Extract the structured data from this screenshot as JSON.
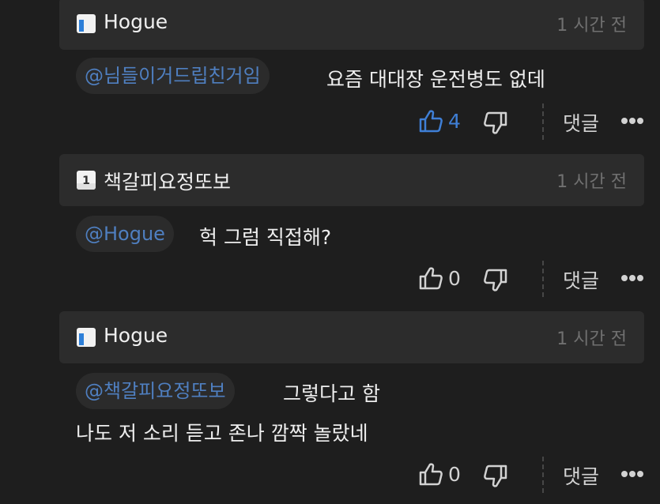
{
  "colors": {
    "background": "#1e1e1e",
    "header_background": "#2c2c2c",
    "mention_blue": "#4f7fc0",
    "liked_blue": "#3f7fd6",
    "level_icon_blue": "#2d7fd8"
  },
  "comments": [
    {
      "level_icon": "level-badge-icon",
      "level_digit": "",
      "nickname": "Hogue",
      "time": "1 시간 전",
      "mention": "@님들이거드립친거임",
      "text_line1": "요즘 대대장 운전병도 없데",
      "text_line2": "",
      "like_count": "4",
      "liked": true,
      "reply_label": "댓글"
    },
    {
      "level_icon": "level-badge-icon",
      "level_digit": "1",
      "nickname": "책갈피요정또보",
      "time": "1 시간 전",
      "mention": "@Hogue",
      "text_line1": "헉 그럼 직접해?",
      "text_line2": "",
      "like_count": "0",
      "liked": false,
      "reply_label": "댓글"
    },
    {
      "level_icon": "level-badge-icon",
      "level_digit": "",
      "nickname": "Hogue",
      "time": "1 시간 전",
      "mention": "@책갈피요정또보",
      "text_line1": "그렇다고 함",
      "text_line2": "나도 저 소리 듣고 존나 깜짝 놀랐네",
      "like_count": "0",
      "liked": false,
      "reply_label": "댓글"
    }
  ]
}
